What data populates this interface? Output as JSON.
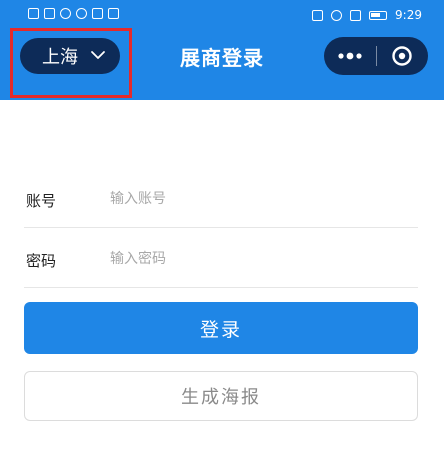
{
  "status_bar": {
    "time": "9:29"
  },
  "header": {
    "city": "上海",
    "title": "展商登录"
  },
  "form": {
    "account_label": "账号",
    "account_placeholder": "输入账号",
    "password_label": "密码",
    "password_placeholder": "输入密码"
  },
  "buttons": {
    "login": "登录",
    "generate_poster": "生成海报"
  },
  "icons": {
    "city": "chevron-down-icon",
    "more": "more-dots-icon",
    "close": "target-close-icon"
  },
  "colors": {
    "header_blue": "#1f86e6",
    "capsule_dark": "#0d2b58",
    "annotation_red": "#e52a2a"
  }
}
